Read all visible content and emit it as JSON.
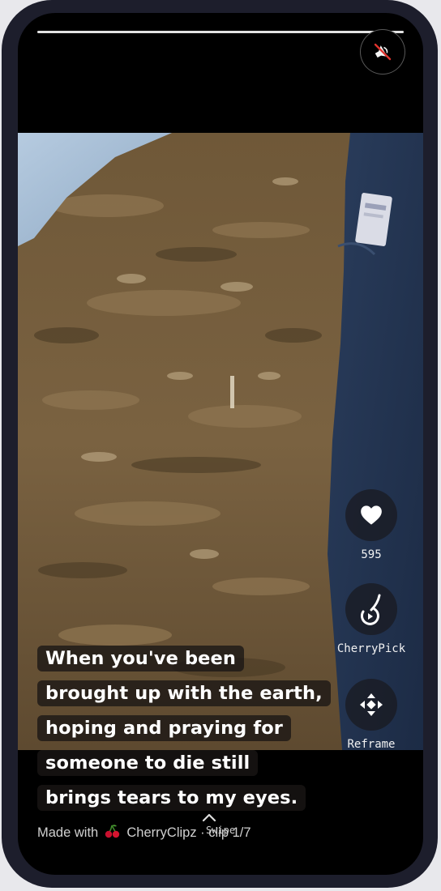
{
  "player": {
    "progress": 1.0,
    "clip_label": "clip 1/7"
  },
  "actions": {
    "like": {
      "icon": "heart-icon",
      "count": "595"
    },
    "cherrypick": {
      "icon": "cherry-stem-icon",
      "label": "CherryPick"
    },
    "reframe": {
      "icon": "move-arrows-icon",
      "label": "Reframe"
    }
  },
  "mute": {
    "icon": "speaker-muted-icon"
  },
  "caption": {
    "lines": [
      "When you've been",
      "brought up with the earth,",
      "hoping and praying for",
      "someone to die still",
      "brings tears to my eyes."
    ]
  },
  "footer": {
    "made_with": "Made with",
    "brand_icon": "cherry-icon",
    "brand": "CherryClipz",
    "separator": "·",
    "clip": "clip 1/7"
  },
  "swipe": {
    "icon": "chevron-up-icon",
    "label": "Swipe"
  }
}
